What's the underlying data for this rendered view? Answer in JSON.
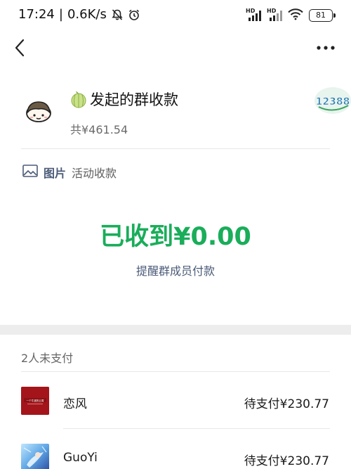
{
  "status_bar": {
    "time": "17:24",
    "speed": "0.6K/s",
    "sep": "|",
    "hd1": "HD",
    "hd2": "HD",
    "battery": "81"
  },
  "nav": {
    "back_icon": "chevron-left-icon",
    "more_icon": "more-dots-icon"
  },
  "header": {
    "title_emoji": "🍈",
    "title": "发起的群收款",
    "total": "共¥461.54",
    "logo_text": "12388"
  },
  "activity": {
    "image_label": "图片",
    "label": "活动收款"
  },
  "summary": {
    "received": "已收到¥0.00",
    "remind": "提醒群成员付款"
  },
  "unpaid": {
    "title": "2人未支付",
    "members": [
      {
        "name": "恋风",
        "status": "待支付¥230.77",
        "avatar_text": "一个牛逼的云霄"
      },
      {
        "name": "GuoYi",
        "status": "待支付¥230.77"
      }
    ]
  },
  "colors": {
    "accent_green": "#1aad5a",
    "link_blue": "#4b5b78"
  }
}
